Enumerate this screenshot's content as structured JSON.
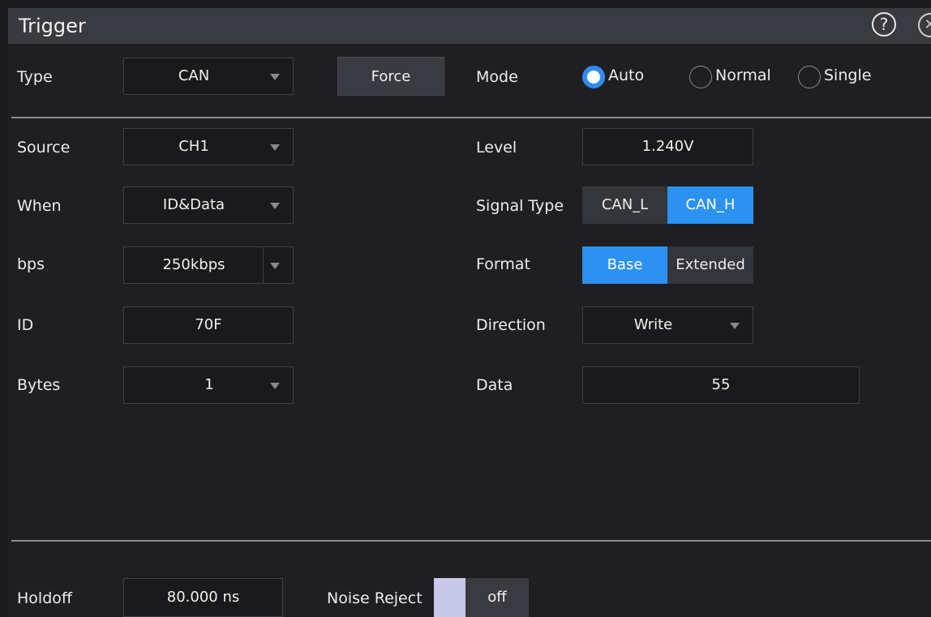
{
  "window": {
    "title": "Trigger"
  },
  "icons": {
    "help": "?",
    "close": "✕"
  },
  "type": {
    "label": "Type",
    "value": "CAN"
  },
  "force": {
    "label": "Force"
  },
  "mode": {
    "label": "Mode",
    "options": [
      "Auto",
      "Normal",
      "Single"
    ],
    "selected": "Auto"
  },
  "source": {
    "label": "Source",
    "value": "CH1"
  },
  "level": {
    "label": "Level",
    "value": "1.240V"
  },
  "when": {
    "label": "When",
    "value": "ID&Data"
  },
  "signal_type": {
    "label": "Signal Type",
    "options": [
      "CAN_L",
      "CAN_H"
    ],
    "selected": "CAN_H"
  },
  "bps": {
    "label": "bps",
    "value": "250kbps"
  },
  "format": {
    "label": "Format",
    "options": [
      "Base",
      "Extended"
    ],
    "selected": "Base"
  },
  "id": {
    "label": "ID",
    "value": "70F"
  },
  "direction": {
    "label": "Direction",
    "value": "Write"
  },
  "bytes": {
    "label": "Bytes",
    "value": "1"
  },
  "data": {
    "label": "Data",
    "value": "55"
  },
  "holdoff": {
    "label": "Holdoff",
    "value": "80.000 ns"
  },
  "noise_reject": {
    "label": "Noise Reject",
    "value": "off"
  },
  "colors": {
    "accent": "#2b92f2",
    "background": "#1f1f23",
    "titlebar": "#3a3b40"
  }
}
